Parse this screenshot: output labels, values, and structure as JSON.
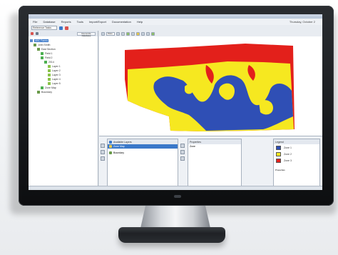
{
  "app": {
    "menu": [
      "File",
      "Database",
      "Reports",
      "Tools",
      "Import/Export",
      "Documentation",
      "Help"
    ],
    "datetime": "Thursday, October 2",
    "toolbar_combo": "Reference Tasks"
  },
  "left_panel": {
    "header_button": "Reconcile Database",
    "tree": [
      {
        "label": "ABC Farms",
        "depth": 0,
        "selected": true
      },
      {
        "label": "John Smith",
        "depth": 1
      },
      {
        "label": "East Section",
        "depth": 2
      },
      {
        "label": "Field 1",
        "depth": 3
      },
      {
        "label": "Field 2",
        "depth": 3
      },
      {
        "label": "2014",
        "depth": 4
      },
      {
        "label": "Layer 1",
        "depth": 5
      },
      {
        "label": "Layer 2",
        "depth": 5
      },
      {
        "label": "Layer 3",
        "depth": 5
      },
      {
        "label": "Layer 4",
        "depth": 5
      },
      {
        "label": "Layer 5",
        "depth": 5
      },
      {
        "label": "Zone Map",
        "depth": 3
      },
      {
        "label": "Boundary",
        "depth": 2
      }
    ]
  },
  "map_toolbar": {
    "combo": "Zone"
  },
  "bottom": {
    "layers_title": "Available Layers",
    "layers": [
      {
        "label": "Zone Map",
        "selected": true
      },
      {
        "label": "Boundary",
        "selected": false
      }
    ],
    "properties_title": "Properties",
    "properties": [
      "Zone"
    ],
    "legend_title": "Legend",
    "legend": [
      {
        "label": "Zone 1",
        "color": "#2f4fb5"
      },
      {
        "label": "Zone 2",
        "color": "#f6e820"
      },
      {
        "label": "Zone 3",
        "color": "#e3201b"
      }
    ],
    "legend_footer": "Properties"
  },
  "map": {
    "zone_colors": {
      "red": "#e3201b",
      "yellow": "#f6e820",
      "blue": "#2f4fb5"
    }
  }
}
